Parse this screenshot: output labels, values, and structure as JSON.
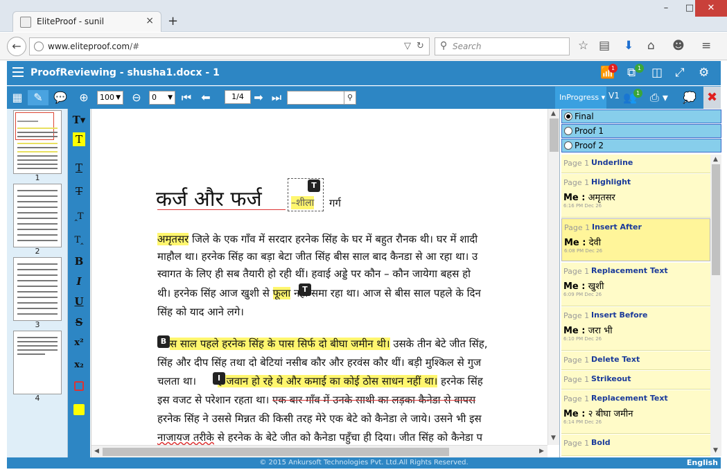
{
  "browser": {
    "tab_title": "EliteProof - sunil",
    "tab_close": "×",
    "new_tab": "+",
    "url_host": "www.eliteproof.com",
    "url_path": "/#",
    "search_placeholder": "Search",
    "win_minimize": "–",
    "win_maximize": "□",
    "win_close": "✕"
  },
  "app": {
    "title": "ProofReviewing - shusha1.docx - 1",
    "badges": {
      "wifi": "1",
      "cloud": "1",
      "users": "1"
    }
  },
  "toolbar": {
    "zoom_value": "100",
    "rotation_value": "0",
    "page_indicator": "1/4",
    "status": "InProgress",
    "version": "V1"
  },
  "thumbnails": [
    {
      "label": "1"
    },
    {
      "label": "2"
    },
    {
      "label": "3"
    },
    {
      "label": "4"
    }
  ],
  "format_tools": [
    {
      "name": "text-format",
      "glyph": "T▾"
    },
    {
      "name": "highlight",
      "glyph": "T"
    },
    {
      "name": "underline",
      "glyph": "T"
    },
    {
      "name": "strikeout",
      "glyph": "T"
    },
    {
      "name": "insert-before",
      "glyph": "‸T"
    },
    {
      "name": "insert-after",
      "glyph": "T‸"
    },
    {
      "name": "bold",
      "glyph": "B"
    },
    {
      "name": "italic",
      "glyph": "I"
    },
    {
      "name": "underline-u",
      "glyph": "U"
    },
    {
      "name": "strike-s",
      "glyph": "S"
    },
    {
      "name": "superscript",
      "glyph": "x²"
    },
    {
      "name": "subscript",
      "glyph": "x₂"
    }
  ],
  "document": {
    "title": "कर्ज और फर्ज",
    "inserted_text": "–शीला",
    "author": "गर्ग",
    "marker_T1": "T",
    "marker_T2": "T",
    "marker_B": "B",
    "marker_I": "I",
    "para1": {
      "l1_hl": "अमृतसर",
      "l1_rest": " जिले के एक गाँव में सरदार हरनेक सिंह के घर में बहुत रौनक थी। घर में शादी",
      "l2": "माहौल था। हरनेक सिंह का बड़ा बेटा जीत सिंह बीस साल बाद कैनडा से आ रहा था। उ",
      "l3": "स्वागत के लिए ही सब तैयारी हो रही थीं। हवाई अड्डे पर कौन – कौन जायेगा बहस हो",
      "l4_a": "थी। हरनेक सिंह आज खुशी से ",
      "l4_hl": "फूला",
      "l4_b": " नहीं समा रहा था। आज से बीस साल पहले के दिन",
      "l5": "सिंह को याद आने लगे।"
    },
    "para2": {
      "l1_hl": "स साल पहले हरनेक सिंह के पास सिर्फ दो बीघा जमीन थी।",
      "l1_rest": " उसके तीन बेटे जीत सिंह,",
      "l2": "सिंह और दीप सिंह तथा दो बेटियां नसीब कौर और हरवंस कौर थीं। बड़ी मुश्किल से गुज",
      "l3_a": "चलता था। ",
      "l3_hl": "ह जवान हो रहे थे और कमाई का कोई ठोस साधन नहीं था।",
      "l3_b": " हरनेक सिंह",
      "l4_a": "इस वजट से परेशान रहता था। ",
      "l4_strike": "एक बार गाँव में उनके साथी का लड़का कैनेडा से वापस",
      "l5": "हरनेक सिंह ने उससे मिन्नत की किसी तरह मेरे एक बेटे को कैनेडा ले जाये। उसने भी इस",
      "l6_strike": "नाजायज तरीके",
      "l6_rest": " से हरनेक के बेटे जीत को कैनेडा पहुँचा ही दिया। जीत सिंह को कैनेडा प"
    }
  },
  "proofs": [
    {
      "label": "Final",
      "selected": true
    },
    {
      "label": "Proof 1",
      "selected": false
    },
    {
      "label": "Proof 2",
      "selected": false
    }
  ],
  "comments": [
    {
      "page": "Page 1",
      "type": "Underline",
      "who": "",
      "text": "",
      "date": ""
    },
    {
      "page": "Page 1",
      "type": "Highlight",
      "who": "Me :",
      "text": "अमृतसर",
      "date": "6:16 PM Dec 26"
    },
    {
      "page": "Page 1",
      "type": "Insert After",
      "who": "Me :",
      "text": "देवी",
      "date": "6:08 PM Dec 26"
    },
    {
      "page": "Page 1",
      "type": "Replacement Text",
      "who": "Me :",
      "text": "खुशी",
      "date": "6:09 PM Dec 26"
    },
    {
      "page": "Page 1",
      "type": "Insert Before",
      "who": "Me :",
      "text": "जरा भी",
      "date": "6:10 PM Dec 26"
    },
    {
      "page": "Page 1",
      "type": "Delete Text",
      "who": "",
      "text": "",
      "date": ""
    },
    {
      "page": "Page 1",
      "type": "Strikeout",
      "who": "",
      "text": "",
      "date": ""
    },
    {
      "page": "Page 1",
      "type": "Replacement Text",
      "who": "Me :",
      "text": "२ बीघा जमीन",
      "date": "6:14 PM Dec 26"
    },
    {
      "page": "Page 1",
      "type": "Bold",
      "who": "",
      "text": "",
      "date": ""
    }
  ],
  "footer": {
    "copyright": "© 2015 Ankursoft Technologies Pvt. Ltd.All Rights Reserved.",
    "language": "English"
  },
  "colors": {
    "brand_blue": "#2d86c4",
    "highlight_yellow": "#fff66e",
    "comment_bg": "#fffbc8",
    "proof_row": "#87ceeb"
  }
}
